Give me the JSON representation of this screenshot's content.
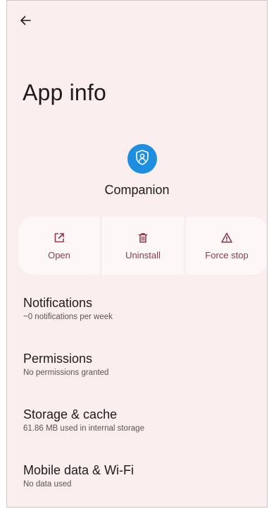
{
  "header": {
    "back_icon": "arrow-back-icon",
    "title": "App info"
  },
  "app": {
    "icon": "shield-person-icon",
    "icon_color": "#1d8ee0",
    "name": "Companion"
  },
  "actions": [
    {
      "label": "Open",
      "icon": "open-external-icon"
    },
    {
      "label": "Uninstall",
      "icon": "trash-icon"
    },
    {
      "label": "Force stop",
      "icon": "warning-icon"
    }
  ],
  "settings": [
    {
      "title": "Notifications",
      "subtitle": "~0 notifications per week"
    },
    {
      "title": "Permissions",
      "subtitle": "No permissions granted"
    },
    {
      "title": "Storage & cache",
      "subtitle": "61.86 MB used in internal storage"
    },
    {
      "title": "Mobile data & Wi-Fi",
      "subtitle": "No data used"
    }
  ],
  "colors": {
    "background": "#fbeeee",
    "accent": "#8e3a4b"
  }
}
